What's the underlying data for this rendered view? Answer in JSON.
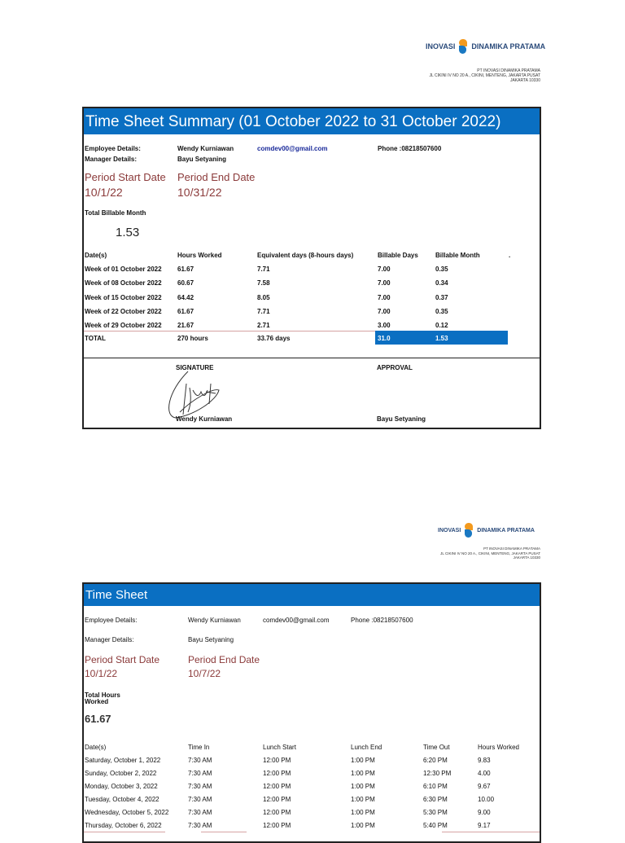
{
  "company": {
    "logo_left": "INOVASI",
    "logo_right": "DINAMIKA PRATAMA",
    "name": "PT INOVASI DINAMIKA PRATAMA",
    "address_line1": "JL CIKINI IV NO 20 A., CIKINI, MENTENG, JAKARTA PUSAT",
    "address_line2": "JAKARTA 10330"
  },
  "summary": {
    "title": "Time Sheet Summary (01 October 2022 to 31 October 2022)",
    "employee_label": "Employee Details:",
    "employee_name": "Wendy Kurniawan",
    "email": "comdev00@gmail.com",
    "phone": "Phone :08218507600",
    "manager_label": "Manager Details:",
    "manager_name": "Bayu Setyaning",
    "start_label": "Period Start Date",
    "start_value": "10/1/22",
    "end_label": "Period End Date",
    "end_value": "10/31/22",
    "total_label": "Total Billable Month",
    "total_value": "1.53",
    "headers": [
      "Date(s)",
      "Hours Worked",
      "Equivalent days (8-hours days)",
      "Billable Days",
      "Billable Month",
      "."
    ],
    "rows": [
      [
        "Week of 01 October 2022",
        "61.67",
        "7.71",
        "7.00",
        "0.35"
      ],
      [
        "Week of 08 October 2022",
        "60.67",
        "7.58",
        "7.00",
        "0.34"
      ],
      [
        "Week of 15 October 2022",
        "64.42",
        "8.05",
        "7.00",
        "0.37"
      ],
      [
        "Week of 22 October 2022",
        "61.67",
        "7.71",
        "7.00",
        "0.35"
      ],
      [
        "Week of 29 October 2022",
        "21.67",
        "2.71",
        "3.00",
        "0.12"
      ]
    ],
    "total_row": [
      "TOTAL",
      "270 hours",
      "33.76 days",
      "31.0",
      "1.53"
    ],
    "signature_label": "SIGNATURE",
    "approval_label": "APPROVAL",
    "signer": "Wendy Kurniawan",
    "approver": "Bayu Setyaning",
    "accent": "#0a6fc2"
  },
  "sheet": {
    "title": "Time Sheet",
    "employee_label": "Employee Details:",
    "employee_name": "Wendy Kurniawan",
    "email": "comdev00@gmail.com",
    "phone": "Phone :08218507600",
    "manager_label": "Manager Details:",
    "manager_name": "Bayu Setyaning",
    "start_label": "Period Start Date",
    "start_value": "10/1/22",
    "end_label": "Period End Date",
    "end_value": "10/7/22",
    "total_label_1": "Total Hours",
    "total_label_2": "Worked",
    "total_value": "61.67",
    "headers": [
      "Date(s)",
      "Time In",
      "Lunch Start",
      "Lunch End",
      "Time Out",
      "Hours Worked"
    ],
    "rows": [
      [
        "Saturday, October 1, 2022",
        "7:30 AM",
        "12:00 PM",
        "1:00 PM",
        "6:20 PM",
        "9.83"
      ],
      [
        "Sunday, October 2, 2022",
        "7:30 AM",
        "12:00 PM",
        "1:00 PM",
        "12:30 PM",
        "4.00"
      ],
      [
        "Monday, October 3, 2022",
        "7:30 AM",
        "12:00 PM",
        "1:00 PM",
        "6:10 PM",
        "9.67"
      ],
      [
        "Tuesday, October 4, 2022",
        "7:30 AM",
        "12:00 PM",
        "1:00 PM",
        "6:30 PM",
        "10.00"
      ],
      [
        "Wednesday, October 5, 2022",
        "7:30 AM",
        "12:00 PM",
        "1:00 PM",
        "5:30 PM",
        "9.00"
      ],
      [
        "Thursday, October 6, 2022",
        "7:30 AM",
        "12:00 PM",
        "1:00 PM",
        "5:40 PM",
        "9.17"
      ]
    ]
  }
}
